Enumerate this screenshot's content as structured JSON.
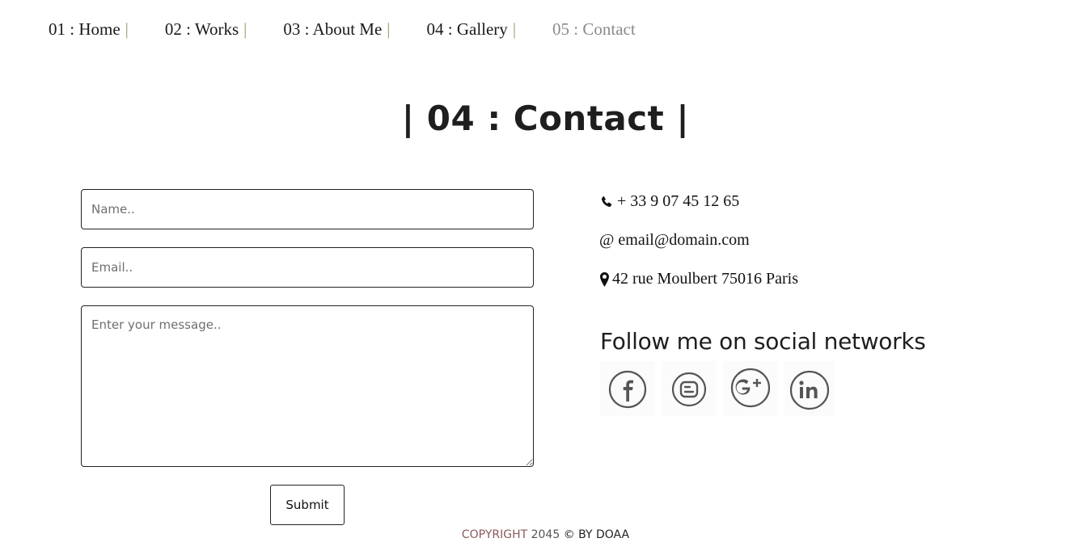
{
  "nav": {
    "items": [
      {
        "label": "01 : Home",
        "sep": "|"
      },
      {
        "label": "02 : Works",
        "sep": "|"
      },
      {
        "label": "03 : About Me",
        "sep": "|"
      },
      {
        "label": "04 : Gallery",
        "sep": "|"
      },
      {
        "label": "05 : Contact",
        "sep": ""
      }
    ],
    "active_index": 4
  },
  "page_title": "| 04 : Contact |",
  "form": {
    "name_placeholder": "Name..",
    "email_placeholder": "Email..",
    "message_placeholder": "Enter your message..",
    "submit_label": "Submit"
  },
  "contact": {
    "phone": "+ 33 9 07 45 12 65",
    "email_symbol": "@",
    "email": "email@domain.com",
    "address": "42 rue Moulbert 75016 Paris"
  },
  "social": {
    "heading": "Follow me on social networks",
    "icons": [
      "facebook-icon",
      "blogger-icon",
      "google-plus-icon",
      "linkedin-icon"
    ]
  },
  "footer": {
    "copyright_word": "COPYRIGHT",
    "year": "2045",
    "rest": "© BY DOAA"
  },
  "colors": {
    "nav_active": "#8a8a8a",
    "nav_separator": "#9b9b6a",
    "footer_copyright": "#8a5a5a"
  }
}
